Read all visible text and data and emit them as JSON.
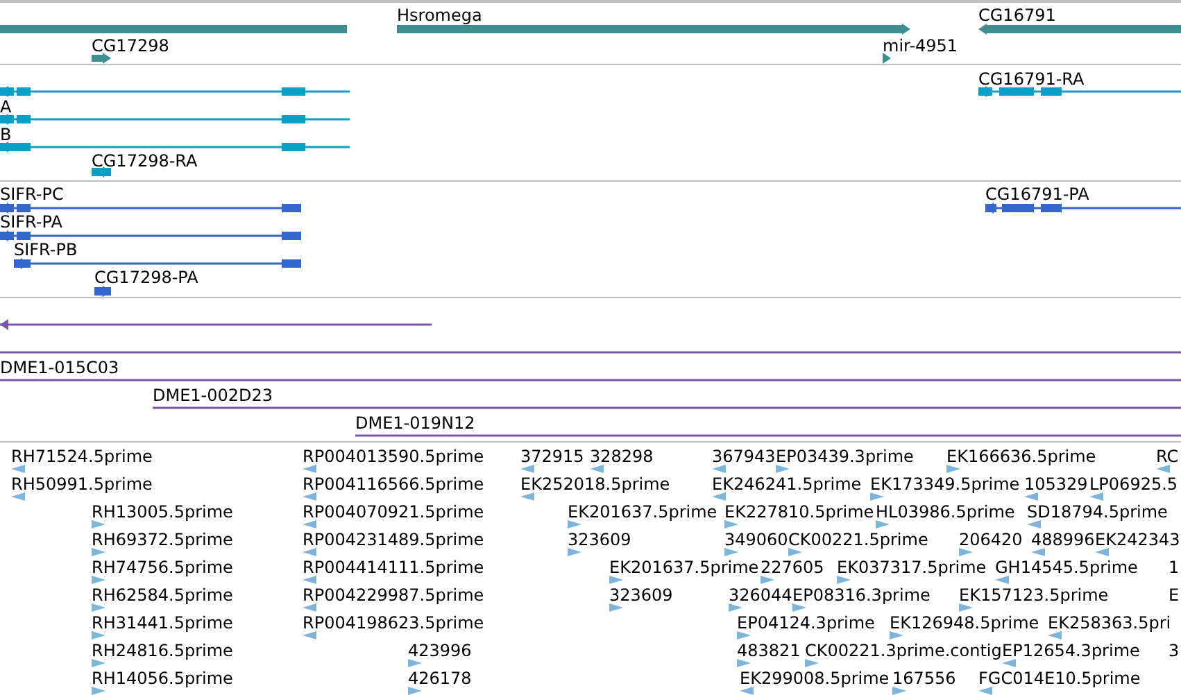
{
  "tracks": [
    {
      "kind": "gene",
      "features": [
        {
          "reverse": true
        },
        {
          "label": "Hsromega",
          "reverse": false
        },
        {
          "label": "CG16791",
          "reverse": true
        },
        {
          "label": "CG17298",
          "reverse": false
        },
        {
          "label": "mir-4951",
          "reverse": false
        }
      ]
    },
    {
      "kind": "transcript",
      "features": [
        {
          "reverse": true
        },
        {
          "label": "CG16791-RA",
          "reverse": true
        },
        {
          "label": "A",
          "reverse": true
        },
        {
          "label": "B",
          "reverse": true
        },
        {
          "label": "CG17298-RA",
          "reverse": false
        }
      ]
    },
    {
      "kind": "protein",
      "features": [
        {
          "label": "SIFR-PC",
          "reverse": true
        },
        {
          "label": "CG16791-PA",
          "reverse": true
        },
        {
          "label": "SIFR-PA",
          "reverse": true
        },
        {
          "label": "SIFR-PB",
          "reverse": true
        },
        {
          "label": "CG17298-PA",
          "reverse": false
        }
      ]
    },
    {
      "kind": "clone",
      "features": [
        {
          "reverse": true
        },
        {
          "reverse": true
        },
        {
          "label": "DME1-015C03",
          "reverse": true
        },
        {
          "label": "DME1-002D23",
          "reverse": false
        },
        {
          "label": "DME1-019N12",
          "reverse": false
        }
      ]
    },
    {
      "kind": "est",
      "features": [
        {
          "label": "RH71524.5prime",
          "reverse": true
        },
        {
          "label": "RP004013590.5prime",
          "reverse": true
        },
        {
          "label": "372915",
          "reverse": true
        },
        {
          "label": "328298",
          "reverse": true
        },
        {
          "label": "367943",
          "reverse": true
        },
        {
          "label": "EP03439.3prime",
          "reverse": false
        },
        {
          "label": "EK166636.5prime",
          "reverse": false
        },
        {
          "label": "RC",
          "reverse": true
        },
        {
          "label": "RH50991.5prime",
          "reverse": true
        },
        {
          "label": "RP004116566.5prime",
          "reverse": true
        },
        {
          "label": "EK252018.5prime",
          "reverse": true
        },
        {
          "label": "EK246241.5prime",
          "reverse": true
        },
        {
          "label": "EK173349.5prime",
          "reverse": false
        },
        {
          "label": "105329",
          "reverse": true
        },
        {
          "label": "LP06925.5",
          "reverse": true
        },
        {
          "label": "RH13005.5prime",
          "reverse": false
        },
        {
          "label": "RP004070921.5prime",
          "reverse": true
        },
        {
          "label": "EK201637.5prime",
          "reverse": false
        },
        {
          "label": "EK227810.5prime",
          "reverse": false
        },
        {
          "label": "HL03986.5prime",
          "reverse": false
        },
        {
          "label": "SD18794.5prime",
          "reverse": true
        },
        {
          "label": "RH69372.5prime",
          "reverse": false
        },
        {
          "label": "RP004231489.5prime",
          "reverse": true
        },
        {
          "label": "323609",
          "reverse": false
        },
        {
          "label": "349060",
          "reverse": false
        },
        {
          "label": "CK00221.5prime",
          "reverse": false
        },
        {
          "label": "206420",
          "reverse": false
        },
        {
          "label": "488996",
          "reverse": true
        },
        {
          "label": "EK242343",
          "reverse": true
        },
        {
          "label": "RH74756.5prime",
          "reverse": false
        },
        {
          "label": "RP004414111.5prime",
          "reverse": true
        },
        {
          "label": "EK201637.5prime",
          "reverse": false
        },
        {
          "label": "227605",
          "reverse": false
        },
        {
          "label": "EK037317.5prime",
          "reverse": false
        },
        {
          "label": "GH14545.5prime",
          "reverse": true
        },
        {
          "label": "1"
        },
        {
          "label": "RH62584.5prime",
          "reverse": false
        },
        {
          "label": "RP004229987.5prime",
          "reverse": true
        },
        {
          "label": "323609",
          "reverse": false
        },
        {
          "label": "326044",
          "reverse": false
        },
        {
          "label": "EP08316.3prime",
          "reverse": false
        },
        {
          "label": "EK157123.5prime",
          "reverse": false
        },
        {
          "label": "E"
        },
        {
          "label": "RH31441.5prime",
          "reverse": false
        },
        {
          "label": "RP004198623.5prime",
          "reverse": true
        },
        {
          "label": "EP04124.3prime",
          "reverse": false
        },
        {
          "label": "EK126948.5prime",
          "reverse": false
        },
        {
          "label": "EK258363.5pri",
          "reverse": true
        },
        {
          "label": "RH24816.5prime",
          "reverse": false
        },
        {
          "label": "423996",
          "reverse": false
        },
        {
          "label": "483821",
          "reverse": false
        },
        {
          "label": "CK00221.3prime.contig",
          "reverse": false
        },
        {
          "label": "EP12654.3prime",
          "reverse": true
        },
        {
          "label": "3"
        },
        {
          "label": "RH14056.5prime",
          "reverse": false
        },
        {
          "label": "426178",
          "reverse": false
        },
        {
          "label": "EK299008.5prime",
          "reverse": true
        },
        {
          "label": "167556",
          "reverse": false
        },
        {
          "label": "FGC014E10.5prime",
          "reverse": true
        }
      ]
    }
  ]
}
